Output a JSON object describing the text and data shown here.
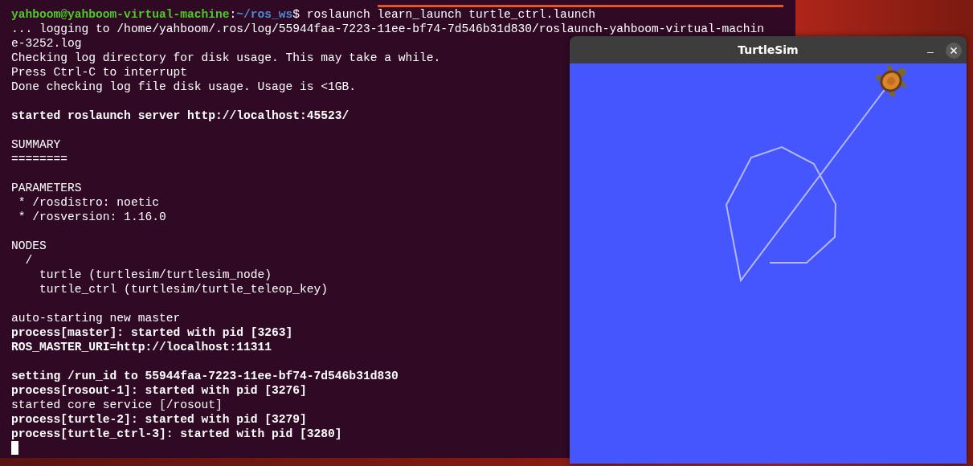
{
  "terminal": {
    "prompt": {
      "user_host": "yahboom@yahboom-virtual-machine",
      "separator": ":",
      "path": "~/ros_ws",
      "symbol": "$",
      "command": "roslaunch learn_launch turtle_ctrl.launch"
    },
    "lines": [
      {
        "kind": "text",
        "text": "... logging to /home/yahboom/.ros/log/55944faa-7223-11ee-bf74-7d546b31d830/roslaunch-yahboom-virtual-machin",
        "bold": false
      },
      {
        "kind": "text",
        "text": "e-3252.log",
        "bold": false
      },
      {
        "kind": "text",
        "text": "Checking log directory for disk usage. This may take a while.",
        "bold": false
      },
      {
        "kind": "text",
        "text": "Press Ctrl-C to interrupt",
        "bold": false
      },
      {
        "kind": "text",
        "text": "Done checking log file disk usage. Usage is <1GB.",
        "bold": false
      },
      {
        "kind": "blank"
      },
      {
        "kind": "text",
        "text": "started roslaunch server http://localhost:45523/",
        "bold": true
      },
      {
        "kind": "blank"
      },
      {
        "kind": "text",
        "text": "SUMMARY",
        "bold": false
      },
      {
        "kind": "text",
        "text": "========",
        "bold": false
      },
      {
        "kind": "blank"
      },
      {
        "kind": "text",
        "text": "PARAMETERS",
        "bold": false
      },
      {
        "kind": "text",
        "text": " * /rosdistro: noetic",
        "bold": false
      },
      {
        "kind": "text",
        "text": " * /rosversion: 1.16.0",
        "bold": false
      },
      {
        "kind": "blank"
      },
      {
        "kind": "text",
        "text": "NODES",
        "bold": false
      },
      {
        "kind": "text",
        "text": "  /",
        "bold": false
      },
      {
        "kind": "text",
        "text": "    turtle (turtlesim/turtlesim_node)",
        "bold": false
      },
      {
        "kind": "text",
        "text": "    turtle_ctrl (turtlesim/turtle_teleop_key)",
        "bold": false
      },
      {
        "kind": "blank"
      },
      {
        "kind": "text",
        "text": "auto-starting new master",
        "bold": false
      },
      {
        "kind": "text",
        "text": "process[master]: started with pid [3263]",
        "bold": true
      },
      {
        "kind": "text",
        "text": "ROS_MASTER_URI=http://localhost:11311",
        "bold": true
      },
      {
        "kind": "blank"
      },
      {
        "kind": "text",
        "text": "setting /run_id to 55944faa-7223-11ee-bf74-7d546b31d830",
        "bold": true
      },
      {
        "kind": "text",
        "text": "process[rosout-1]: started with pid [3276]",
        "bold": true
      },
      {
        "kind": "text",
        "text": "started core service [/rosout]",
        "bold": false
      },
      {
        "kind": "text",
        "text": "process[turtle-2]: started with pid [3279]",
        "bold": true
      },
      {
        "kind": "text",
        "text": "process[turtle_ctrl-3]: started with pid [3280]",
        "bold": true
      },
      {
        "kind": "cursor"
      }
    ]
  },
  "turtlesim_window": {
    "title": "TurtleSim"
  }
}
